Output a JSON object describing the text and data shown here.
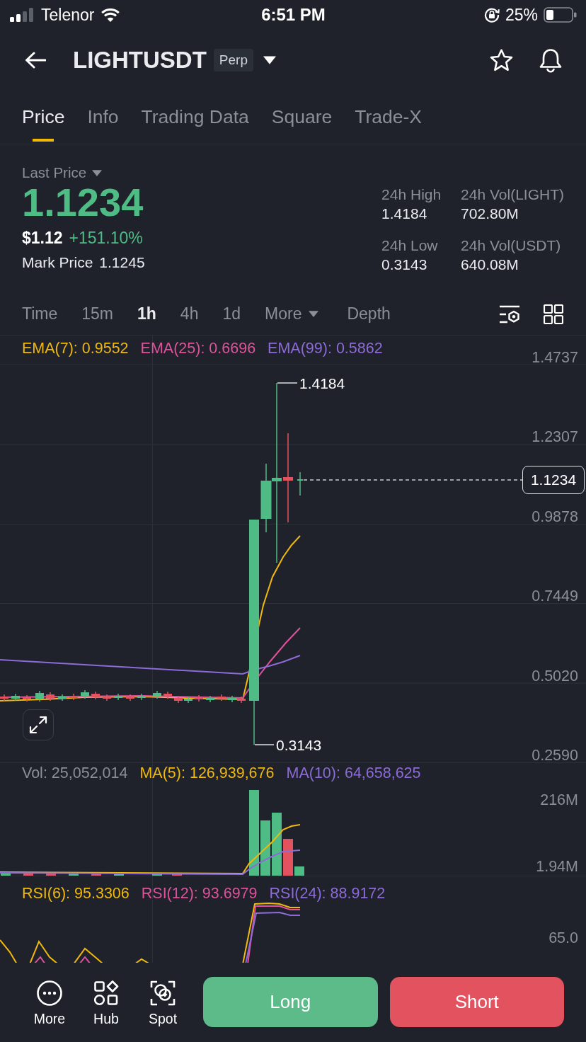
{
  "status_bar": {
    "carrier": "Telenor",
    "time": "6:51 PM",
    "battery": "25%"
  },
  "header": {
    "symbol": "LIGHTUSDT",
    "badge": "Perp"
  },
  "tabs": [
    {
      "label": "Price",
      "selected": true
    },
    {
      "label": "Info",
      "selected": false
    },
    {
      "label": "Trading Data",
      "selected": false
    },
    {
      "label": "Square",
      "selected": false
    },
    {
      "label": "Trade-X",
      "selected": false
    }
  ],
  "price_summary": {
    "label": "Last Price",
    "last_price": "1.1234",
    "usd_price": "$1.12",
    "change": "+151.10%",
    "mark_price_label": "Mark Price",
    "mark_price": "1.1245"
  },
  "stats": [
    {
      "label": "24h High",
      "value": "1.4184"
    },
    {
      "label": "24h Vol(LIGHT)",
      "value": "702.80M"
    },
    {
      "label": "24h Low",
      "value": "0.3143"
    },
    {
      "label": "24h Vol(USDT)",
      "value": "640.08M"
    }
  ],
  "intervals": [
    {
      "label": "Time",
      "kind": "interval",
      "selected": false
    },
    {
      "label": "15m",
      "kind": "interval",
      "selected": false
    },
    {
      "label": "1h",
      "kind": "interval",
      "selected": true
    },
    {
      "label": "4h",
      "kind": "interval",
      "selected": false
    },
    {
      "label": "1d",
      "kind": "interval",
      "selected": false
    },
    {
      "label": "More",
      "kind": "menu",
      "selected": false
    },
    {
      "label": "Depth",
      "kind": "view",
      "selected": false
    }
  ],
  "price_chart": {
    "indicators": [
      {
        "label": "EMA(7): 0.9552",
        "color": "#f0b90b"
      },
      {
        "label": "EMA(25): 0.6696",
        "color": "#e0529c"
      },
      {
        "label": "EMA(99): 0.5862",
        "color": "#8d6bd8"
      }
    ],
    "axis_labels": [
      "1.4737",
      "1.2307",
      "0.9878",
      "0.7449",
      "0.5020",
      "0.2590"
    ],
    "high": "1.4184",
    "low": "0.3143",
    "current_price": "1.1234"
  },
  "volume_chart": {
    "indicators": [
      {
        "label": "Vol: 25,052,014",
        "color": "#8a8f99"
      },
      {
        "label": "MA(5): 126,939,676",
        "color": "#f0b90b"
      },
      {
        "label": "MA(10): 64,658,625",
        "color": "#8d6bd8"
      }
    ],
    "axis_labels": [
      "216M",
      "1.94M"
    ]
  },
  "rsi_chart": {
    "indicators": [
      {
        "label": "RSI(6): 95.3306",
        "color": "#f0b90b"
      },
      {
        "label": "RSI(12): 93.6979",
        "color": "#e0529c"
      },
      {
        "label": "RSI(24): 88.9172",
        "color": "#8d6bd8"
      }
    ],
    "axis_labels": [
      "65.0"
    ]
  },
  "bottom_bar": {
    "items": [
      {
        "label": "More"
      },
      {
        "label": "Hub"
      },
      {
        "label": "Spot"
      }
    ],
    "actions": [
      {
        "label": "Long",
        "kind": "long"
      },
      {
        "label": "Short",
        "kind": "short"
      }
    ]
  }
}
